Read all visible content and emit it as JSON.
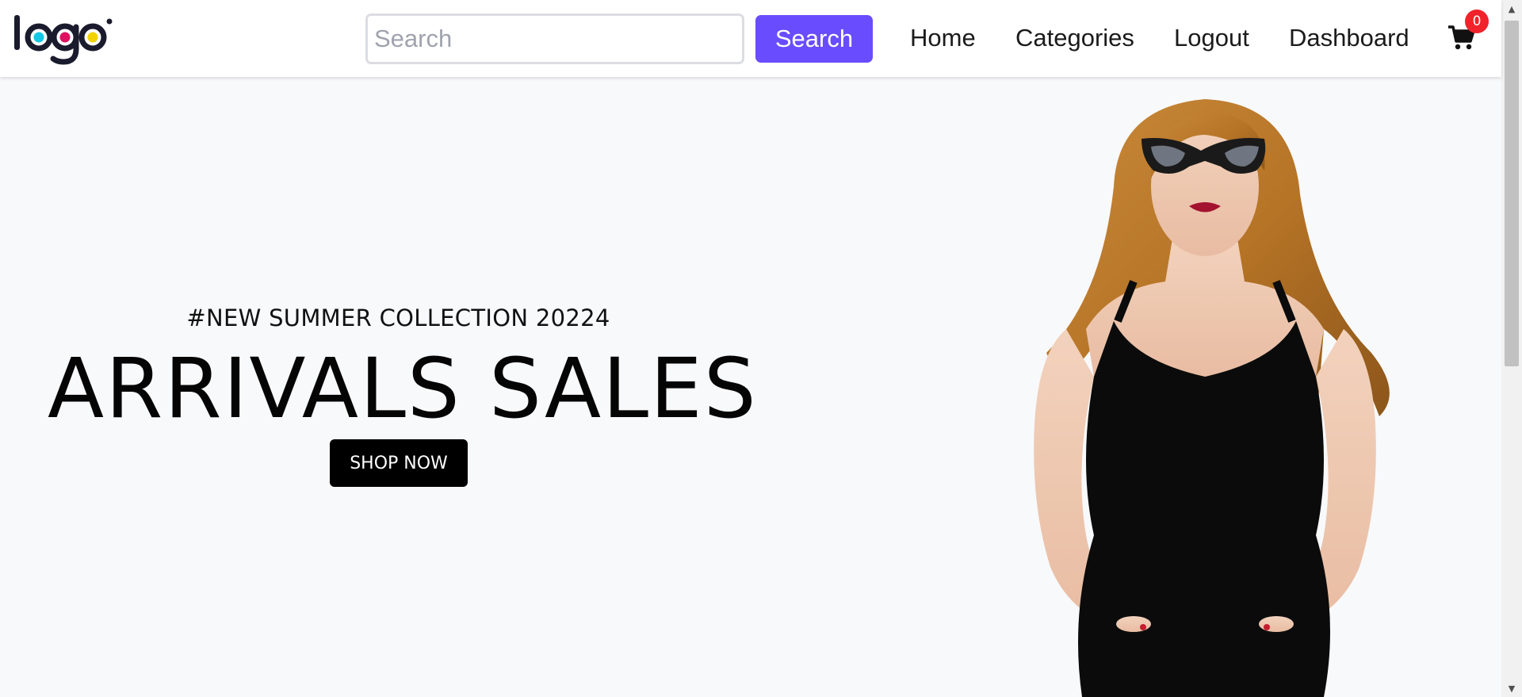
{
  "header": {
    "logo_text": "logo",
    "logo_dot_colors": [
      "#12c8e6",
      "#e0115f",
      "#f2d300"
    ],
    "search": {
      "placeholder": "Search",
      "value": "",
      "button_label": "Search"
    },
    "nav": {
      "home": "Home",
      "categories": "Categories",
      "logout": "Logout",
      "dashboard": "Dashboard"
    },
    "cart": {
      "icon": "shopping-cart-icon",
      "count": "0"
    }
  },
  "hero": {
    "subtitle": "#NEW SUMMER COLLECTION 20224",
    "title": "ARRIVALS SALES",
    "cta_label": "SHOP NOW",
    "image_description_icon": "model-photo"
  },
  "colors": {
    "accent": "#6a4cff",
    "badge": "#f0222a",
    "background": "#f8f9fb"
  }
}
